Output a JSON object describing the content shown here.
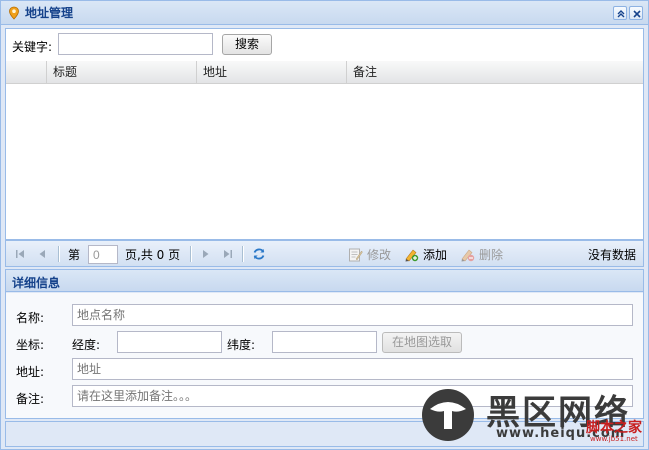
{
  "window": {
    "title": "地址管理",
    "pin_icon": "map-pin-icon",
    "collapse_icon": "double-chevron-up-icon",
    "close_icon": "close-icon"
  },
  "search": {
    "label": "关键字:",
    "value": "",
    "button_label": "搜索"
  },
  "grid": {
    "columns": [
      "标题",
      "地址",
      "备注"
    ],
    "rows": []
  },
  "pager": {
    "page_prefix": "第",
    "page_value": "0",
    "page_suffix": "页,共 0 页",
    "edit_label": "修改",
    "add_label": "添加",
    "delete_label": "删除",
    "status": "没有数据"
  },
  "detail": {
    "title": "详细信息",
    "name_label": "名称:",
    "name_placeholder": "地点名称",
    "coord_label": "坐标:",
    "lng_label": "经度:",
    "lat_label": "纬度:",
    "map_button": "在地图选取",
    "address_label": "地址:",
    "address_placeholder": "地址",
    "remark_label": "备注:",
    "remark_placeholder": "请在这里添加备注。。。"
  },
  "watermark": {
    "text": "黑区网络",
    "url": "www.heiqu.com",
    "site": "脚本之家",
    "site_url": "www.jb51.net"
  },
  "colors": {
    "panel_border": "#99bbe8",
    "panel_bg": "#dfe8f6",
    "title_text": "#15428b",
    "watermark_red": "#c81e1e"
  }
}
